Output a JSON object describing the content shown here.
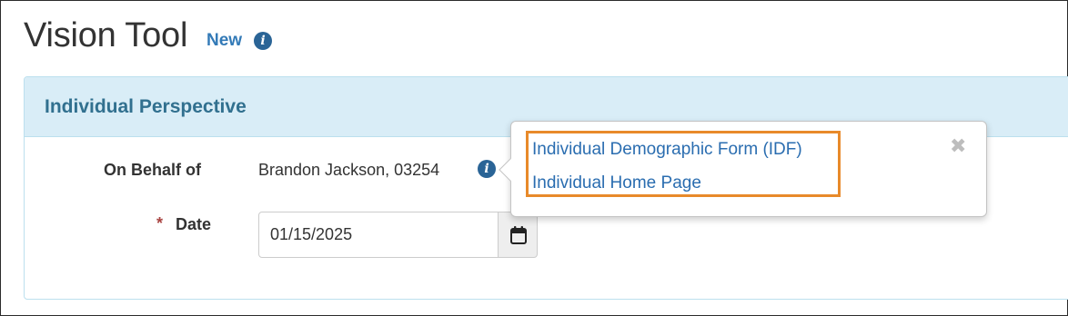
{
  "page": {
    "title": "Vision Tool",
    "new_label": "New"
  },
  "panel": {
    "title": "Individual Perspective"
  },
  "form": {
    "behalf_label": "On Behalf of",
    "behalf_value": "Brandon Jackson, 03254",
    "date_required_marker": "*",
    "date_label": "Date",
    "date_value": "01/15/2025"
  },
  "popover": {
    "links": [
      {
        "label": "Individual Demographic Form (IDF)"
      },
      {
        "label": "Individual Home Page"
      }
    ],
    "close_glyph": "✖"
  },
  "icons": {
    "title_info": "info-circle-icon",
    "behalf_info": "info-circle-icon",
    "calendar": "calendar-icon",
    "close": "close-icon"
  },
  "colors": {
    "link": "#337ab7",
    "panel_heading_bg": "#d9edf7",
    "panel_title": "#31708f",
    "highlight": "#e88a2a",
    "required": "#a94442"
  }
}
